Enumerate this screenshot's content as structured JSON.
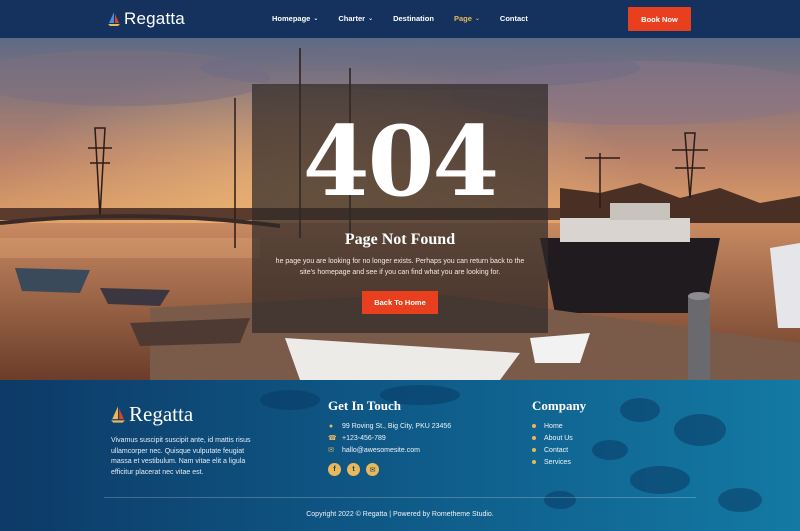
{
  "brand": {
    "name": "Regatta"
  },
  "nav": {
    "items": [
      {
        "label": "Homepage",
        "has_dropdown": true,
        "active": false
      },
      {
        "label": "Charter",
        "has_dropdown": true,
        "active": false
      },
      {
        "label": "Destination",
        "has_dropdown": false,
        "active": false
      },
      {
        "label": "Page",
        "has_dropdown": true,
        "active": true
      },
      {
        "label": "Contact",
        "has_dropdown": false,
        "active": false
      }
    ],
    "cta_label": "Book Now"
  },
  "hero": {
    "code": "404",
    "title": "Page Not Found",
    "description": "he page you are looking for no longer exists. Perhaps you can return back to the site's homepage and see if you can find what you are looking for.",
    "button_label": "Back To Home"
  },
  "footer": {
    "about": "Vivamus suscipit suscipit ante, id mattis risus ullamcorper nec. Quisque vulputate feugiat massa et vestibulum. Nam vitae elit a ligula efficitur placerat nec vitae est.",
    "contact": {
      "title": "Get In Touch",
      "address": "99 Roving St., Big City, PKU 23456",
      "phone": "+123-456-789",
      "email": "hallo@awesomesite.com"
    },
    "company": {
      "title": "Company",
      "links": [
        "Home",
        "About Us",
        "Contact",
        "Services"
      ]
    },
    "copyright": "Copyright 2022 © Regatta | Powered by Rometheme Studio."
  },
  "colors": {
    "nav_bg": "#15325f",
    "accent": "#e8401e",
    "gold": "#e8b85a",
    "footer_sea": "#0f5f8c"
  },
  "icons": {
    "social": [
      "facebook-icon",
      "twitter-icon",
      "email-icon"
    ],
    "contact": [
      "map-pin-icon",
      "phone-icon",
      "mail-icon"
    ]
  }
}
